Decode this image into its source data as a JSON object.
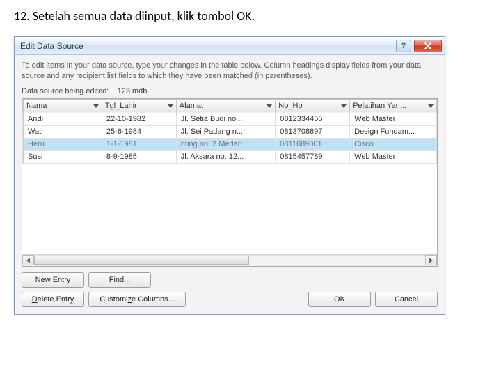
{
  "instruction": "12. Setelah semua data diinput, klik tombol OK.",
  "dialog": {
    "title": "Edit Data Source",
    "help_label": "?",
    "description": "To edit items in your data source, type your changes in the table below. Column headings display fields from your data source and any recipient list fields to which they have been matched (in parentheses).",
    "src_prefix": "Data source being edited:",
    "src_file": "123.mdb",
    "columns": [
      "Nama",
      "Tgl_Lahir",
      "Alamat",
      "No_Hp",
      "Pelatihan Yan..."
    ],
    "rows": [
      {
        "selected": false,
        "cells": [
          "Andi",
          "22-10-1982",
          "Jl. Setia Budi no...",
          "0812334455",
          "Web Master"
        ]
      },
      {
        "selected": false,
        "cells": [
          "Wati",
          "25-6-1984",
          "Jl. Sei Padang n...",
          "0813708897",
          "Design Fundam..."
        ]
      },
      {
        "selected": true,
        "cells": [
          "Heru",
          "1-1-1981",
          "nting no. 2 Medan",
          "0811689001",
          "Cisco"
        ]
      },
      {
        "selected": false,
        "cells": [
          "Susi",
          "8-9-1985",
          "Jl. Aksara no. 12...",
          "0815457789",
          "Web Master"
        ]
      }
    ],
    "buttons": {
      "new_entry": "New Entry",
      "find": "Find...",
      "delete_entry": "Delete Entry",
      "customize": "Customize Columns...",
      "ok": "OK",
      "cancel": "Cancel"
    }
  }
}
